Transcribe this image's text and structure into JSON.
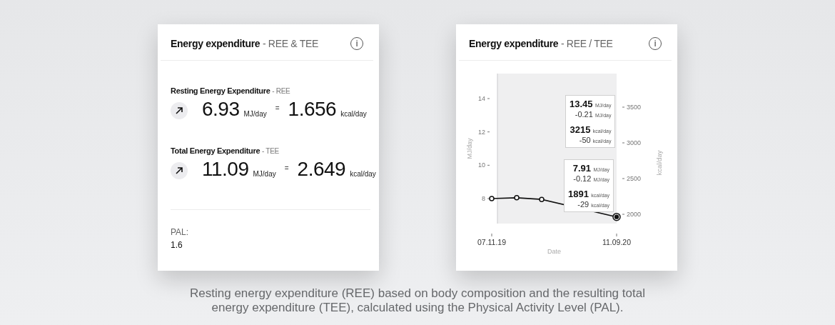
{
  "cards": [
    {
      "kind": "summary",
      "title": "Energy expenditure",
      "subtitle": "- REE & TEE",
      "info": "i",
      "metrics": [
        {
          "label": "Resting Energy Expenditure",
          "abbr": "- REE",
          "mj": "6.93",
          "mj_unit": "MJ/day",
          "equals": "=",
          "kcal": "1.656",
          "kcal_unit": "kcal/day"
        },
        {
          "label": "Total Energy Expenditure",
          "abbr": "- TEE",
          "mj": "11.09",
          "mj_unit": "MJ/day",
          "equals": "=",
          "kcal": "2.649",
          "kcal_unit": "kcal/day"
        }
      ],
      "pal": {
        "label": "PAL:",
        "value": "1.6"
      }
    },
    {
      "kind": "chart",
      "title": "Energy expenditure",
      "subtitle": "- REE / TEE",
      "info": "i",
      "chart_data": {
        "type": "line",
        "xlabel": "Date",
        "ylabel": "MJ/day",
        "categories": [
          "07.11.19",
          null,
          null,
          null,
          null,
          "11.09.20"
        ],
        "ylim": [
          6.5,
          15.5
        ],
        "yticks": [
          8,
          10,
          12,
          14
        ],
        "series": [
          {
            "color": "#111111",
            "values": [
              8.0,
              8.05,
              7.95,
              null,
              null,
              6.9
            ]
          }
        ],
        "y2label": "kcal/day",
        "y2lim": [
          1870,
          3970
        ],
        "y2ticks": [
          2000,
          2500,
          3000,
          3500
        ]
      },
      "tooltips": [
        {
          "value": "13.45",
          "unit": "MJ/day",
          "delta": "-0.21",
          "delta_unit": "MJ/day",
          "kcal": "3215",
          "kcal_unit": "kcal/day",
          "kcal_delta": "-50",
          "kcal_delta_unit": "kcal/day"
        },
        {
          "value": "7.91",
          "unit": "MJ/day",
          "delta": "-0.12",
          "delta_unit": "MJ/day",
          "kcal": "1891",
          "kcal_unit": "kcal/day",
          "kcal_delta": "-29",
          "kcal_delta_unit": "kcal/day"
        }
      ]
    }
  ],
  "caption": "Resting energy expenditure (REE) based on body composition and the resulting total energy expenditure (TEE), calculated using the Physical Activity Level (PAL)."
}
